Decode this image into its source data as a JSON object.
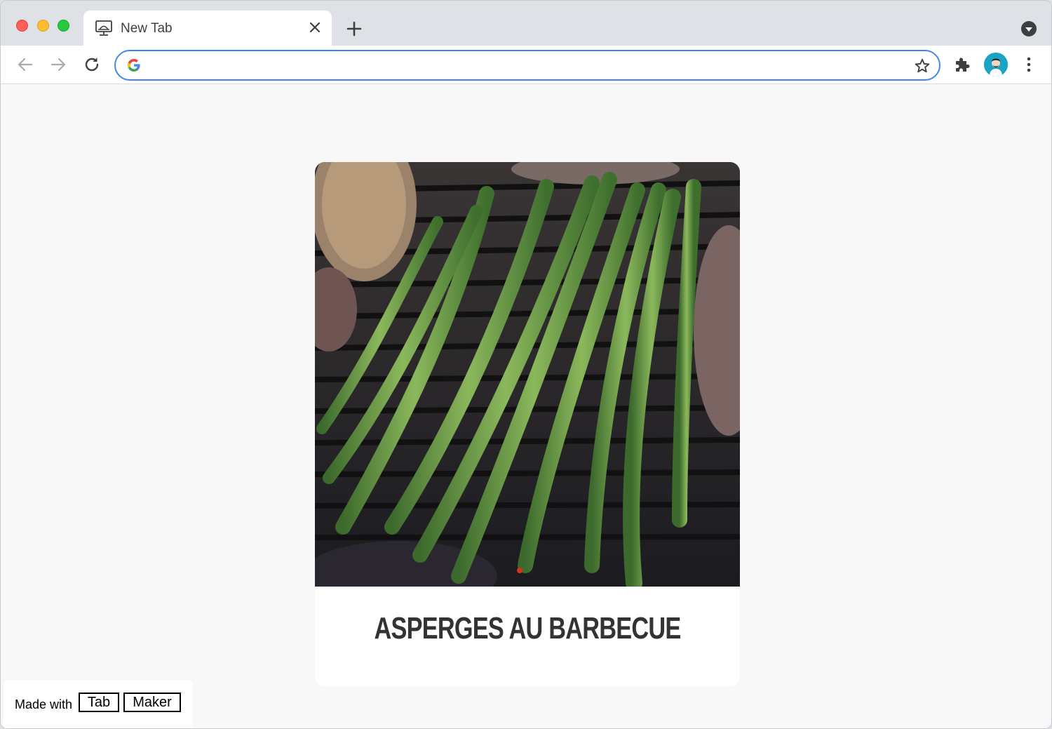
{
  "browser": {
    "tab_title": "New Tab",
    "omnibox_placeholder": "",
    "icons": {
      "tab_favicon": "monitor-icon",
      "close": "close-icon",
      "new_tab": "plus-icon",
      "tab_search": "chevron-down-circle-icon",
      "back": "arrow-left-icon",
      "forward": "arrow-right-icon",
      "reload": "reload-icon",
      "search_engine": "google-g-icon",
      "bookmark": "star-icon",
      "extensions": "puzzle-icon",
      "profile": "avatar-icon",
      "menu": "kebab-menu-icon"
    },
    "colors": {
      "tab_strip": "#dee1e6",
      "omnibox_focus": "#4285f4",
      "page_background": "#f8f8f8"
    }
  },
  "page": {
    "card_title": "ASPERGES AU BARBECUE",
    "card_image": "grilled-asparagus-photo",
    "footer": {
      "made_with": "Made with",
      "tab_label": "Tab",
      "maker_label": "Maker"
    }
  }
}
